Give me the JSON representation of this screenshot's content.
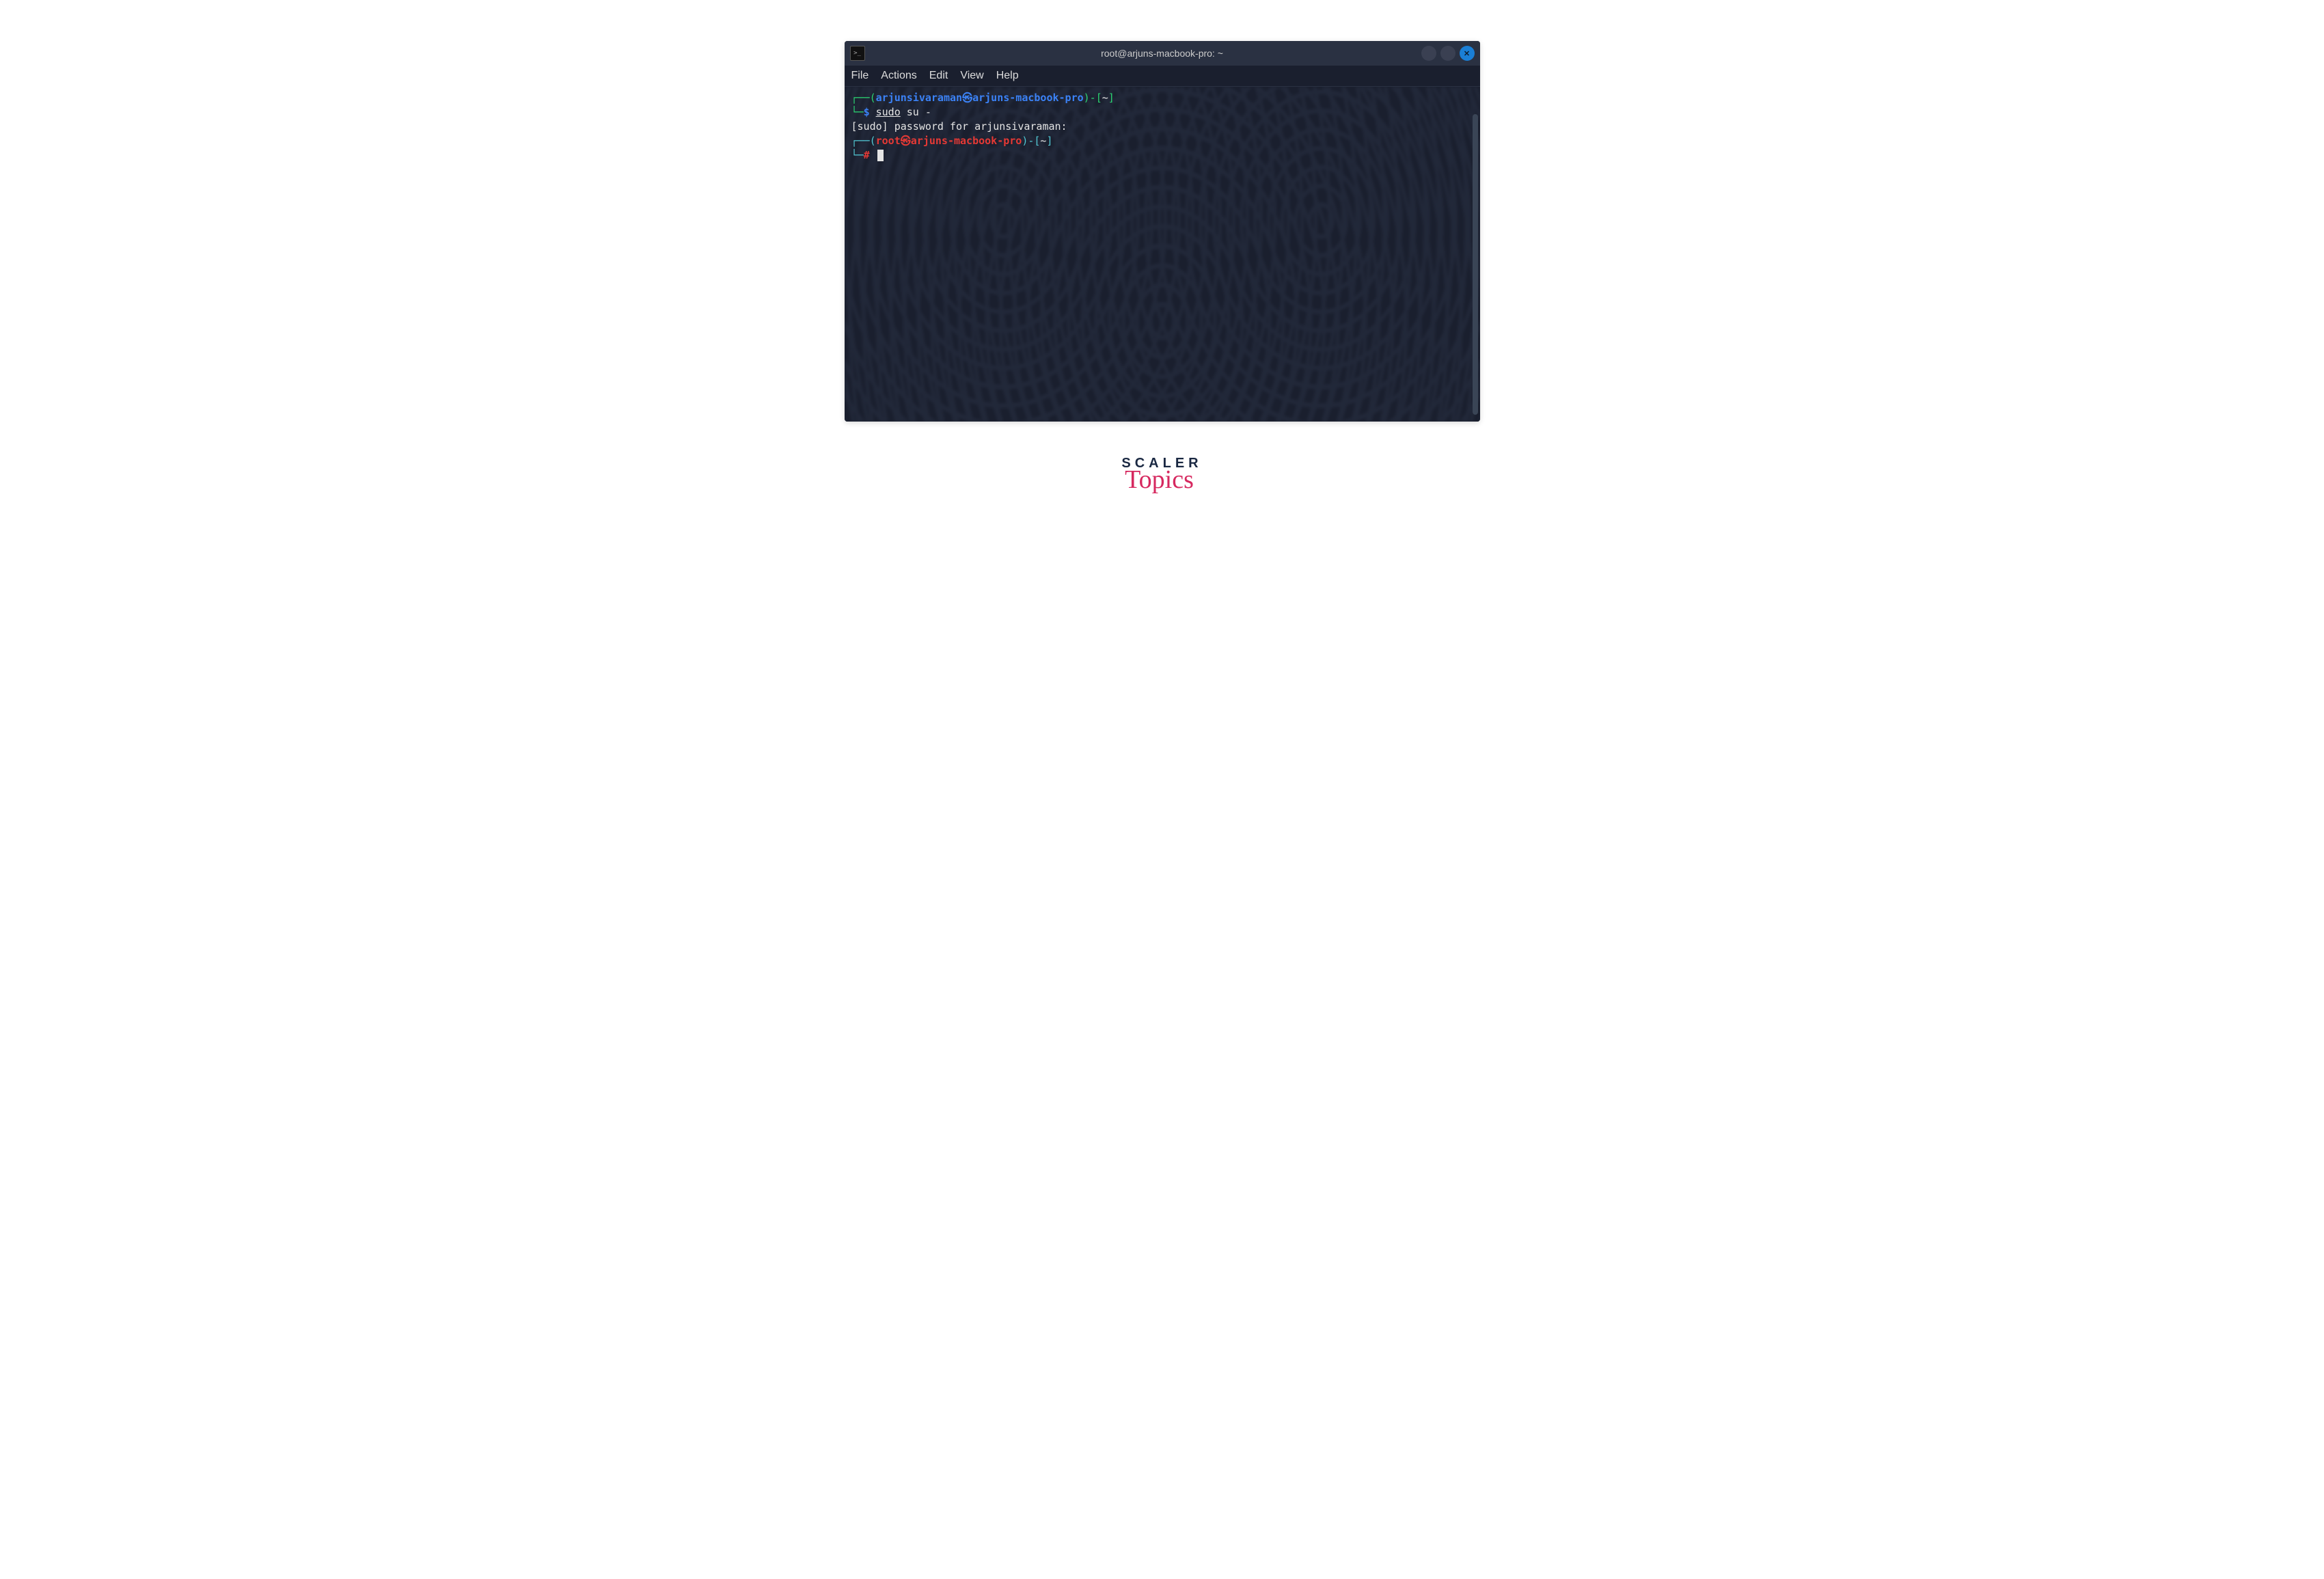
{
  "titlebar": {
    "title": "root@arjuns-macbook-pro: ~"
  },
  "menu": {
    "file": "File",
    "actions": "Actions",
    "edit": "Edit",
    "view": "View",
    "help": "Help"
  },
  "prompt1": {
    "open_corner": "┌──(",
    "user": "arjunsivaraman",
    "at": "㉿",
    "host": "arjuns-macbook-pro",
    "close_paren": ")-[",
    "path": "~",
    "close_bracket": "]",
    "line2_corner": "└─",
    "dollar": "$ ",
    "cmd_sudo": "sudo",
    "cmd_rest": " su -"
  },
  "password_line": "[sudo] password for arjunsivaraman:",
  "prompt2": {
    "open_corner": "┌──(",
    "user": "root",
    "at": "㉿",
    "host": "arjuns-macbook-pro",
    "close_paren": ")-[",
    "path": "~",
    "close_bracket": "]",
    "line2_corner": "└─",
    "hash": "# "
  },
  "brand": {
    "top": "SCALER",
    "script": "Topics"
  }
}
